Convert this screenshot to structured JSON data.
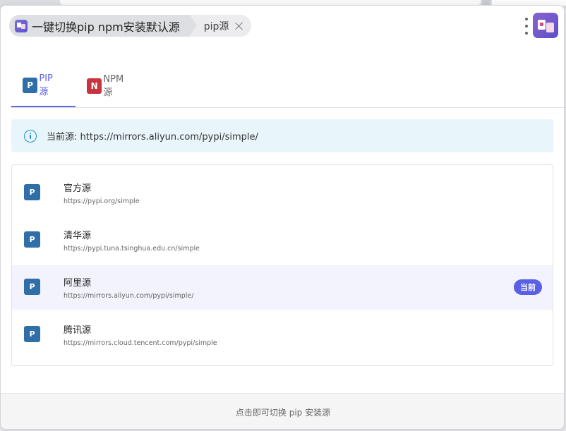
{
  "header": {
    "app_title": "一键切换pip npm安装默认源",
    "tab_title": "pip源"
  },
  "tabs": [
    {
      "badge": "P",
      "label": "PIP 源",
      "active": true
    },
    {
      "badge": "N",
      "label": "NPM 源",
      "active": false
    }
  ],
  "info": {
    "text": "当前源: https://mirrors.aliyun.com/pypi/simple/"
  },
  "sources": [
    {
      "badge": "P",
      "name": "官方源",
      "url": "https://pypi.org/simple",
      "current": false
    },
    {
      "badge": "P",
      "name": "清华源",
      "url": "https://pypi.tuna.tsinghua.edu.cn/simple",
      "current": false
    },
    {
      "badge": "P",
      "name": "阿里源",
      "url": "https://mirrors.aliyun.com/pypi/simple/",
      "current": true
    },
    {
      "badge": "P",
      "name": "腾讯源",
      "url": "https://mirrors.cloud.tencent.com/pypi/simple",
      "current": false
    }
  ],
  "current_label": "当前",
  "footer": {
    "hint": "点击即可切换 pip 安装源"
  },
  "colors": {
    "accent": "#5a60e6",
    "pip_badge": "#2f6ea6",
    "npm_badge": "#c8343d",
    "info_bg": "#e8f6fb"
  }
}
